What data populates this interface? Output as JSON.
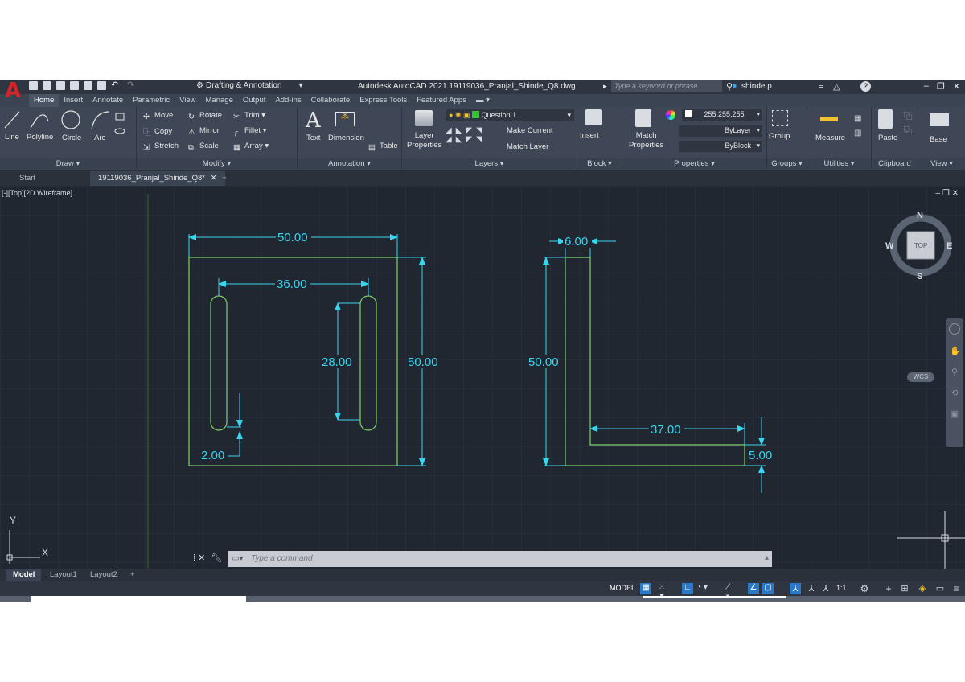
{
  "app": {
    "title": "Autodesk AutoCAD 2021   19119036_Pranjal_Shinde_Q8.dwg",
    "workspace": "Drafting & Annotation",
    "search_placeholder": "Type a keyword or phrase",
    "user": "shinde p"
  },
  "ribbon_tabs": [
    "Home",
    "Insert",
    "Annotate",
    "Parametric",
    "View",
    "Manage",
    "Output",
    "Add-ins",
    "Collaborate",
    "Express Tools",
    "Featured Apps"
  ],
  "draw": {
    "title": "Draw",
    "line": "Line",
    "polyline": "Polyline",
    "circle": "Circle",
    "arc": "Arc"
  },
  "modify": {
    "title": "Modify",
    "move": "Move",
    "rotate": "Rotate",
    "trim": "Trim",
    "copy": "Copy",
    "mirror": "Mirror",
    "fillet": "Fillet",
    "stretch": "Stretch",
    "scale": "Scale",
    "array": "Array"
  },
  "annotation": {
    "title": "Annotation",
    "text": "Text",
    "dimension": "Dimension",
    "table": "Table"
  },
  "layers": {
    "title": "Layers",
    "layer_properties_1": "Layer",
    "layer_properties_2": "Properties",
    "current_layer": "Question 1",
    "make_current": "Make Current",
    "match_layer": "Match Layer"
  },
  "block": {
    "title": "Block",
    "insert": "Insert"
  },
  "properties": {
    "title": "Properties",
    "match_1": "Match",
    "match_2": "Properties",
    "color": "255,255,255",
    "linetype": "ByLayer",
    "lineweight": "ByBlock"
  },
  "groups": {
    "title": "Groups",
    "group": "Group"
  },
  "utilities": {
    "title": "Utilities",
    "measure": "Measure"
  },
  "clipboard": {
    "title": "Clipboard",
    "paste": "Paste"
  },
  "view_panel": {
    "title": "View",
    "base": "Base"
  },
  "file_tabs": {
    "start": "Start",
    "active": "19119036_Pranjal_Shinde_Q8*"
  },
  "viewport": {
    "label": "[-][Top][2D Wireframe]",
    "top": "TOP",
    "n": "N",
    "s": "S",
    "e": "E",
    "w": "W",
    "wcs": "WCS"
  },
  "ucs": {
    "x": "X",
    "y": "Y"
  },
  "dimensions": {
    "d1": "50.00",
    "d2": "36.00",
    "d3": "28.00",
    "d4": "50.00",
    "d5": "2.00",
    "d6": "6.00",
    "d7": "50.00",
    "d8": "37.00",
    "d9": "5.00"
  },
  "command": {
    "placeholder": "Type a command"
  },
  "layout_tabs": [
    "Model",
    "Layout1",
    "Layout2"
  ],
  "status": {
    "model": "MODEL",
    "scale": "1:1"
  },
  "colors": {
    "geometry": "#7fd16a",
    "dimension": "#36d6ef",
    "background": "#212731"
  }
}
